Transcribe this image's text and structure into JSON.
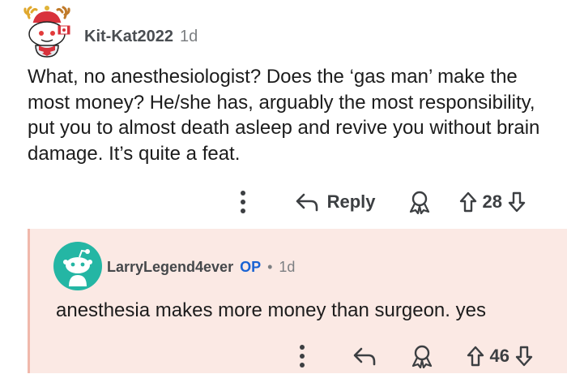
{
  "comment": {
    "username": "Kit-Kat2022",
    "age": "1d",
    "body": "What, no anesthesiologist? Does the ‘gas man’ make the most money? He/she has, arguably the most responsibility, put you to almost death asleep and revive you without brain damage. It’s quite a feat.",
    "actions": {
      "reply_label": "Reply",
      "score": "28"
    }
  },
  "reply": {
    "username": "LarryLegend4ever",
    "op_badge": "OP",
    "separator": "•",
    "age": "1d",
    "body": "anesthesia makes more money than surgeon. yes",
    "actions": {
      "score": "46"
    }
  },
  "colors": {
    "reply_background": "#fbe9e4",
    "thread_line": "#f0b8ab",
    "op_badge": "#1a63d3",
    "avatar2_background": "#24b6a4"
  },
  "icons": [
    "snoo-avatar-icon",
    "more-options-icon",
    "reply-arrow-icon",
    "award-icon",
    "upvote-icon",
    "downvote-icon"
  ]
}
